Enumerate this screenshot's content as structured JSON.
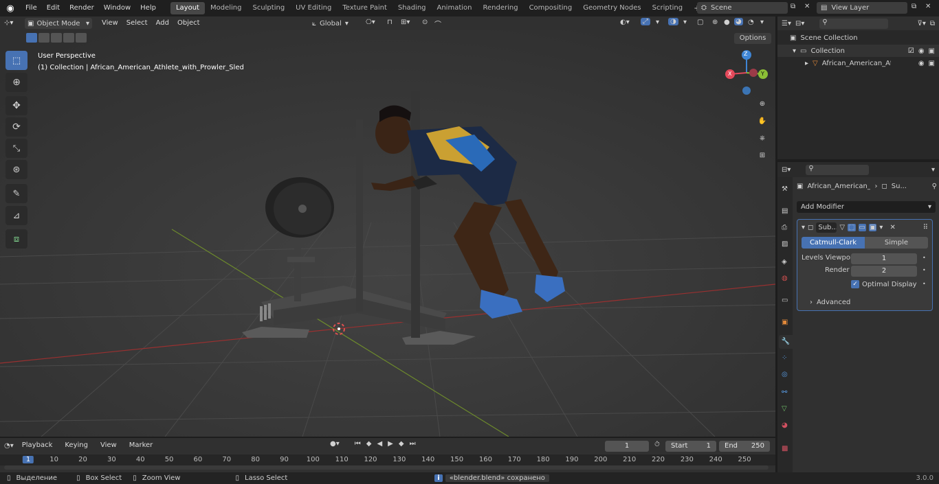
{
  "menus": [
    "File",
    "Edit",
    "Render",
    "Window",
    "Help"
  ],
  "workspaces": [
    "Layout",
    "Modeling",
    "Sculpting",
    "UV Editing",
    "Texture Paint",
    "Shading",
    "Animation",
    "Rendering",
    "Compositing",
    "Geometry Nodes",
    "Scripting"
  ],
  "scene": {
    "label": "Scene",
    "view_layer": "View Layer"
  },
  "viewport": {
    "mode": "Object Mode",
    "menus": [
      "View",
      "Select",
      "Add",
      "Object"
    ],
    "orientation": "Global",
    "options": "Options",
    "overlay_title": "User Perspective",
    "overlay_sub": "(1) Collection | African_American_Athlete_with_Prowler_Sled",
    "gizmo": {
      "x": "X",
      "y": "Y",
      "z": "Z"
    }
  },
  "outliner": {
    "items": [
      "Scene Collection",
      "Collection",
      "African_American_Athlet"
    ]
  },
  "properties": {
    "breadcrumb_obj": "African_American_At...",
    "breadcrumb_mod": "Su...",
    "add_modifier": "Add Modifier",
    "modifier_name": "Sub...",
    "tab_catmull": "Catmull-Clark",
    "tab_simple": "Simple",
    "levels_label": "Levels Viewpor",
    "levels_value": "1",
    "render_label": "Render",
    "render_value": "2",
    "optimal": "Optimal Display",
    "advanced": "Advanced"
  },
  "timeline": {
    "menus": [
      "Playback",
      "Keying",
      "View",
      "Marker"
    ],
    "current": "1",
    "start_label": "Start",
    "start": "1",
    "end_label": "End",
    "end": "250",
    "ruler": [
      "1",
      "10",
      "20",
      "30",
      "40",
      "50",
      "60",
      "70",
      "80",
      "90",
      "100",
      "110",
      "120",
      "130",
      "140",
      "150",
      "160",
      "170",
      "180",
      "190",
      "200",
      "210",
      "220",
      "230",
      "240",
      "250"
    ]
  },
  "status": {
    "select": "Выделение",
    "box": "Box Select",
    "zoom": "Zoom View",
    "lasso": "Lasso Select",
    "message": "«blender.blend» сохранено",
    "version": "3.0.0"
  },
  "colors": {
    "accent": "#4772b3",
    "x_axis": "#e4495b",
    "y_axis": "#8bbf36",
    "z_axis": "#3f86d6",
    "header": "#303030"
  }
}
